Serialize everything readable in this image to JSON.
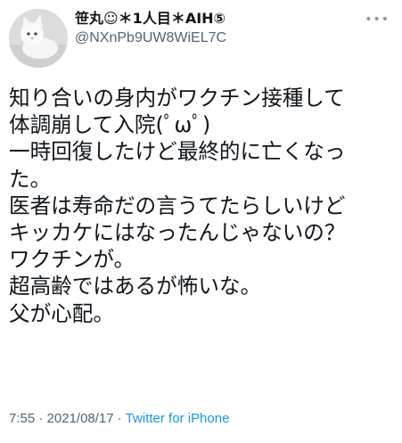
{
  "tweet": {
    "display_name": "笹丸☺︎＊1人目＊AIH⑤",
    "handle": "@NXnPb9UW8WiEL7C",
    "more_label": "•••",
    "lines": [
      "知り合いの身内がワクチン接種して",
      "体調崩して入院(ﾟωﾟ)",
      "一時回復したけど最終的に亡くなっ",
      "た。",
      "医者は寿命だの言うてたらしいけど",
      "キッカケにはなったんじゃないの？",
      "ワクチンが。",
      "超高齢ではあるが怖いな。",
      "父が心配。"
    ],
    "time": "7:55",
    "separator": " · ",
    "date": "2021/08/17",
    "source": "Twitter for iPhone"
  },
  "icons": {
    "avatar": "cat-avatar-photo",
    "more": "more-options-icon"
  }
}
